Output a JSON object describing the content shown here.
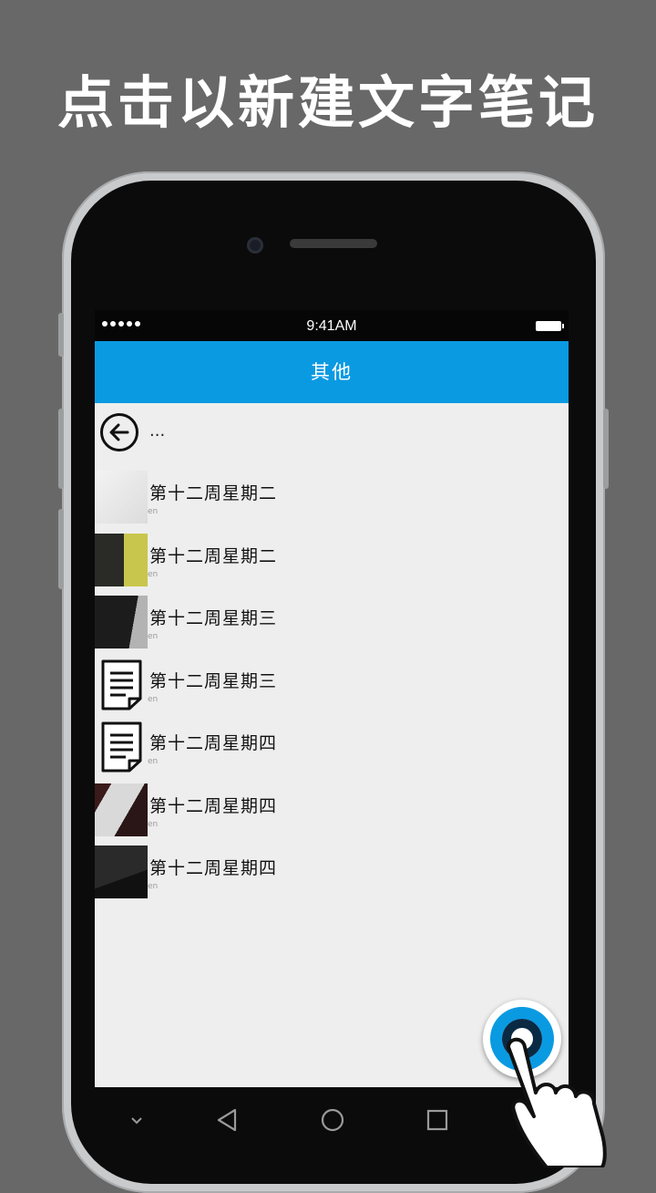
{
  "promo": {
    "headline": "点击以新建文字笔记"
  },
  "status_bar": {
    "time": "9:41AM"
  },
  "app_bar": {
    "title": "其他"
  },
  "back_row": {
    "label": "..."
  },
  "notes": [
    {
      "title": "第十二周星期二",
      "subtitle": "en",
      "thumb": "photo"
    },
    {
      "title": "第十二周星期二",
      "subtitle": "en",
      "thumb": "photo"
    },
    {
      "title": "第十二周星期三",
      "subtitle": "en",
      "thumb": "photo"
    },
    {
      "title": "第十二周星期三",
      "subtitle": "en",
      "thumb": "document-icon"
    },
    {
      "title": "第十二周星期四",
      "subtitle": "en",
      "thumb": "document-icon"
    },
    {
      "title": "第十二周星期四",
      "subtitle": "en",
      "thumb": "photo"
    },
    {
      "title": "第十二周星期四",
      "subtitle": "en",
      "thumb": "photo"
    }
  ],
  "colors": {
    "accent": "#0a9ae2",
    "background": "#686868",
    "list_bg": "#eeeeee"
  },
  "icons": [
    "back-arrow-icon",
    "document-icon",
    "nav-collapse-icon",
    "nav-back-icon",
    "nav-home-icon",
    "nav-recents-icon",
    "add-note-fab-icon",
    "tapping-hand-icon"
  ]
}
